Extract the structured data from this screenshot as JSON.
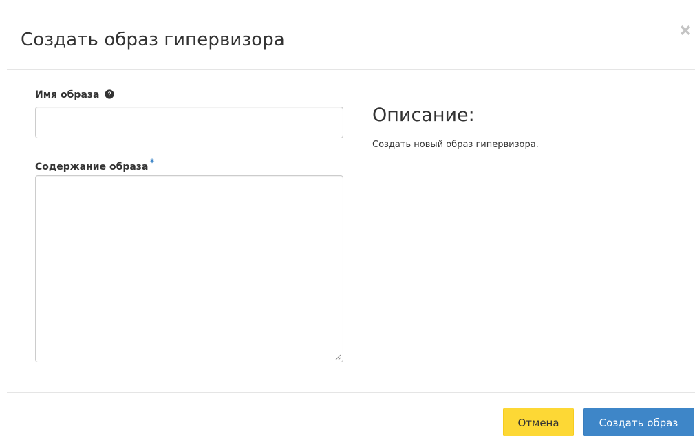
{
  "dialog": {
    "title": "Создать образ гипервизора",
    "close_icon": "close-icon"
  },
  "form": {
    "image_name": {
      "label": "Имя образа",
      "help_icon": "question-circle-icon",
      "value": "",
      "placeholder": ""
    },
    "image_content": {
      "label": "Содержание образа",
      "required_mark": "*",
      "value": "",
      "placeholder": ""
    }
  },
  "description": {
    "title": "Описание:",
    "text": "Создать новый образ гипервизора."
  },
  "footer": {
    "cancel_label": "Отмена",
    "submit_label": "Создать образ"
  },
  "colors": {
    "cancel_button_bg": "#fdd835",
    "submit_button_bg": "#3e86c8",
    "required_mark": "#3e86c8"
  }
}
